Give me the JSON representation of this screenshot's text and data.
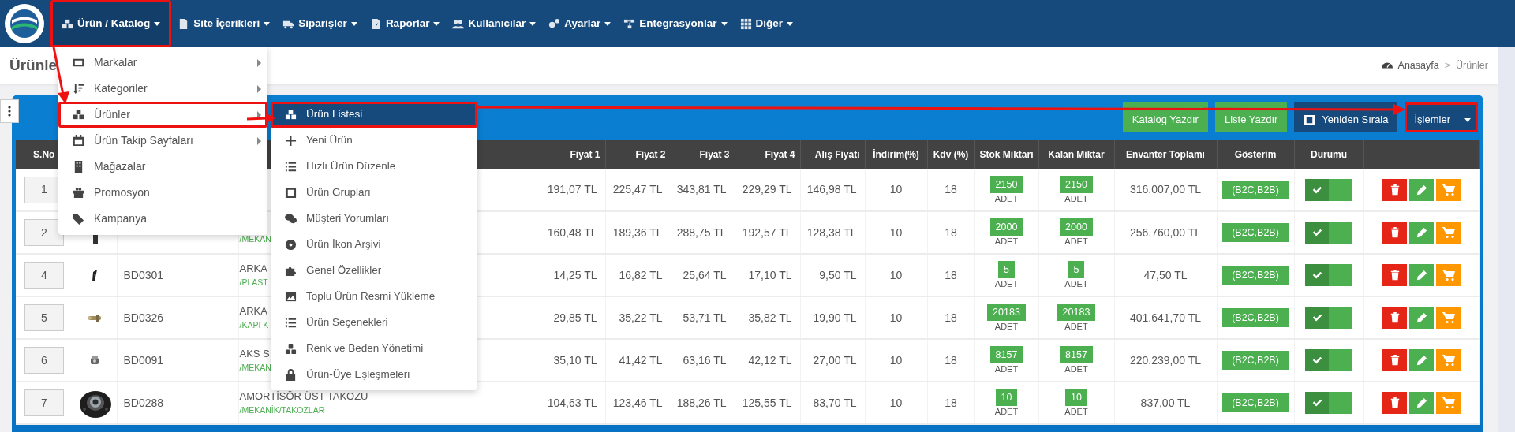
{
  "navbar": {
    "items": [
      {
        "label": "Ürün / Katalog",
        "active": true,
        "highlighted": true
      },
      {
        "label": "Site İçerikleri",
        "active": false,
        "highlighted": false
      },
      {
        "label": "Siparişler",
        "active": false,
        "highlighted": false
      },
      {
        "label": "Raporlar",
        "active": false,
        "highlighted": false
      },
      {
        "label": "Kullanıcılar",
        "active": false,
        "highlighted": false
      },
      {
        "label": "Ayarlar",
        "active": false,
        "highlighted": false
      },
      {
        "label": "Entegrasyonlar",
        "active": false,
        "highlighted": false
      },
      {
        "label": "Diğer",
        "active": false,
        "highlighted": false
      }
    ]
  },
  "page_title": "Ürünle",
  "breadcrumb": {
    "items": [
      "Anasayfa",
      "Ürünler"
    ],
    "separator": ">"
  },
  "menu": {
    "items": [
      {
        "label": "Markalar",
        "has_submenu": true,
        "highlighted": false
      },
      {
        "label": "Kategoriler",
        "has_submenu": true,
        "highlighted": false
      },
      {
        "label": "Ürünler",
        "has_submenu": true,
        "highlighted": true
      },
      {
        "label": "Ürün Takip Sayfaları",
        "has_submenu": true,
        "highlighted": false
      },
      {
        "label": "Mağazalar",
        "has_submenu": false,
        "highlighted": false
      },
      {
        "label": "Promosyon",
        "has_submenu": false,
        "highlighted": false
      },
      {
        "label": "Kampanya",
        "has_submenu": false,
        "highlighted": false
      }
    ]
  },
  "submenu": {
    "items": [
      {
        "label": "Ürün Listesi",
        "selected": true,
        "highlighted": true
      },
      {
        "label": "Yeni Ürün",
        "selected": false,
        "highlighted": false
      },
      {
        "label": "Hızlı Ürün Düzenle",
        "selected": false,
        "highlighted": false
      },
      {
        "label": "Ürün Grupları",
        "selected": false,
        "highlighted": false
      },
      {
        "label": "Müşteri Yorumları",
        "selected": false,
        "highlighted": false
      },
      {
        "label": "Ürün İkon Arşivi",
        "selected": false,
        "highlighted": false
      },
      {
        "label": "Genel Özellikler",
        "selected": false,
        "highlighted": false
      },
      {
        "label": "Toplu Ürün Resmi Yükleme",
        "selected": false,
        "highlighted": false
      },
      {
        "label": "Ürün Seçenekleri",
        "selected": false,
        "highlighted": false
      },
      {
        "label": "Renk ve Beden Yönetimi",
        "selected": false,
        "highlighted": false
      },
      {
        "label": "Ürün-Üye Eşleşmeleri",
        "selected": false,
        "highlighted": false
      }
    ]
  },
  "toolbar": {
    "buttons": [
      {
        "label": "Katalog Yazdır",
        "kind": "success",
        "highlighted": false
      },
      {
        "label": "Liste Yazdır",
        "kind": "success",
        "highlighted": false
      },
      {
        "label": "Yeniden Sırala",
        "kind": "reorder",
        "highlighted": false
      },
      {
        "label": "İşlemler",
        "kind": "split",
        "highlighted": true
      }
    ]
  },
  "table": {
    "columns": [
      "S.No",
      "Fiyat 1",
      "Fiyat 2",
      "Fiyat 3",
      "Fiyat 4",
      "Alış Fiyatı",
      "İndirim(%)",
      "Kdv (%)",
      "Stok Miktarı",
      "Kalan Miktar",
      "Envanter Toplamı",
      "Gösterim",
      "Durumu"
    ],
    "rows": [
      {
        "no": "1",
        "prices": [
          "191,07 TL",
          "225,47 TL",
          "343,81 TL",
          "229,29 TL",
          "146,98 TL"
        ],
        "discount": "10",
        "vat": "18",
        "stock": "2150",
        "stock_unit": "ADET",
        "remaining": "2150",
        "remaining_unit": "ADET",
        "total": "316.007,00 TL",
        "display": "(B2C,B2B)",
        "active": true
      },
      {
        "no": "2",
        "photo": {
          "kind": "picture"
        },
        "category": "/MEKAN",
        "prices": [
          "160,48 TL",
          "189,36 TL",
          "288,75 TL",
          "192,57 TL",
          "128,38 TL"
        ],
        "discount": "10",
        "vat": "18",
        "stock": "2000",
        "stock_unit": "ADET",
        "remaining": "2000",
        "remaining_unit": "ADET",
        "total": "256.760,00 TL",
        "display": "(B2C,B2B)",
        "active": true
      },
      {
        "no": "4",
        "photo": {
          "kind": "picture"
        },
        "code": "BD0301",
        "name": "ARKA",
        "category": "/PLAST",
        "prices": [
          "14,25 TL",
          "16,82 TL",
          "25,64 TL",
          "17,10 TL",
          "9,50 TL"
        ],
        "discount": "10",
        "vat": "18",
        "stock": "5",
        "stock_unit": "ADET",
        "remaining": "5",
        "remaining_unit": "ADET",
        "total": "47,50 TL",
        "display": "(B2C,B2B)",
        "active": true
      },
      {
        "no": "5",
        "photo": {
          "kind": "picture"
        },
        "code": "BD0326",
        "name": "ARKA",
        "category": "/KAPI K",
        "prices": [
          "29,85 TL",
          "35,22 TL",
          "53,71 TL",
          "35,82 TL",
          "19,90 TL"
        ],
        "discount": "10",
        "vat": "18",
        "stock": "20183",
        "stock_unit": "ADET",
        "remaining": "20183",
        "remaining_unit": "ADET",
        "total": "401.641,70 TL",
        "display": "(B2C,B2B)",
        "active": true
      },
      {
        "no": "6",
        "photo": {
          "kind": "picture"
        },
        "code": "BD0091",
        "name": "AKS S",
        "category": "/MEKAN",
        "prices": [
          "35,10 TL",
          "41,42 TL",
          "63,16 TL",
          "42,12 TL",
          "27,00 TL"
        ],
        "discount": "10",
        "vat": "18",
        "stock": "8157",
        "stock_unit": "ADET",
        "remaining": "8157",
        "remaining_unit": "ADET",
        "total": "220.239,00 TL",
        "display": "(B2C,B2B)",
        "active": true
      },
      {
        "no": "7",
        "photo": {
          "kind": "picture"
        },
        "code": "BD0288",
        "name": "AMORTİSÖR ÜST TAKOZU",
        "category": "/MEKANİK/TAKOZLAR",
        "prices": [
          "104,63 TL",
          "123,46 TL",
          "188,26 TL",
          "125,55 TL",
          "83,70 TL"
        ],
        "discount": "10",
        "vat": "18",
        "stock": "10",
        "stock_unit": "ADET",
        "remaining": "10",
        "remaining_unit": "ADET",
        "total": "837,00 TL",
        "display": "(B2C,B2B)",
        "active": true
      }
    ]
  }
}
